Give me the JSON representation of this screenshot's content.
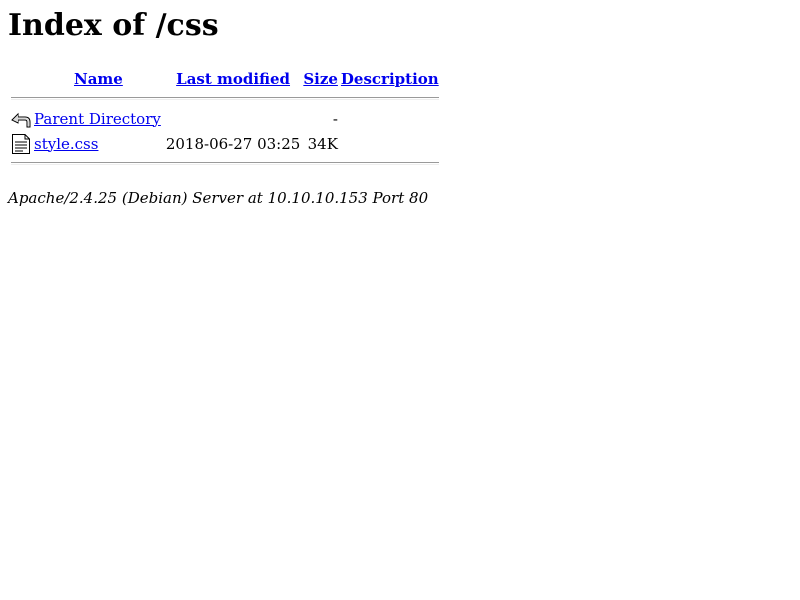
{
  "page": {
    "title": "Index of /css"
  },
  "table": {
    "headers": {
      "name": "Name",
      "last_modified": "Last modified",
      "size": "Size",
      "description": "Description"
    },
    "rows": [
      {
        "icon": "back-arrow-icon",
        "name": "Parent Directory",
        "last_modified": "",
        "size": "-",
        "description": ""
      },
      {
        "icon": "text-file-icon",
        "name": "style.css",
        "last_modified": "2018-06-27 03:25",
        "size": "34K",
        "description": ""
      }
    ]
  },
  "footer": {
    "server_signature": "Apache/2.4.25 (Debian) Server at 10.10.10.153 Port 80"
  },
  "colors": {
    "link": "#0000ee",
    "text": "#000000",
    "background": "#ffffff"
  }
}
